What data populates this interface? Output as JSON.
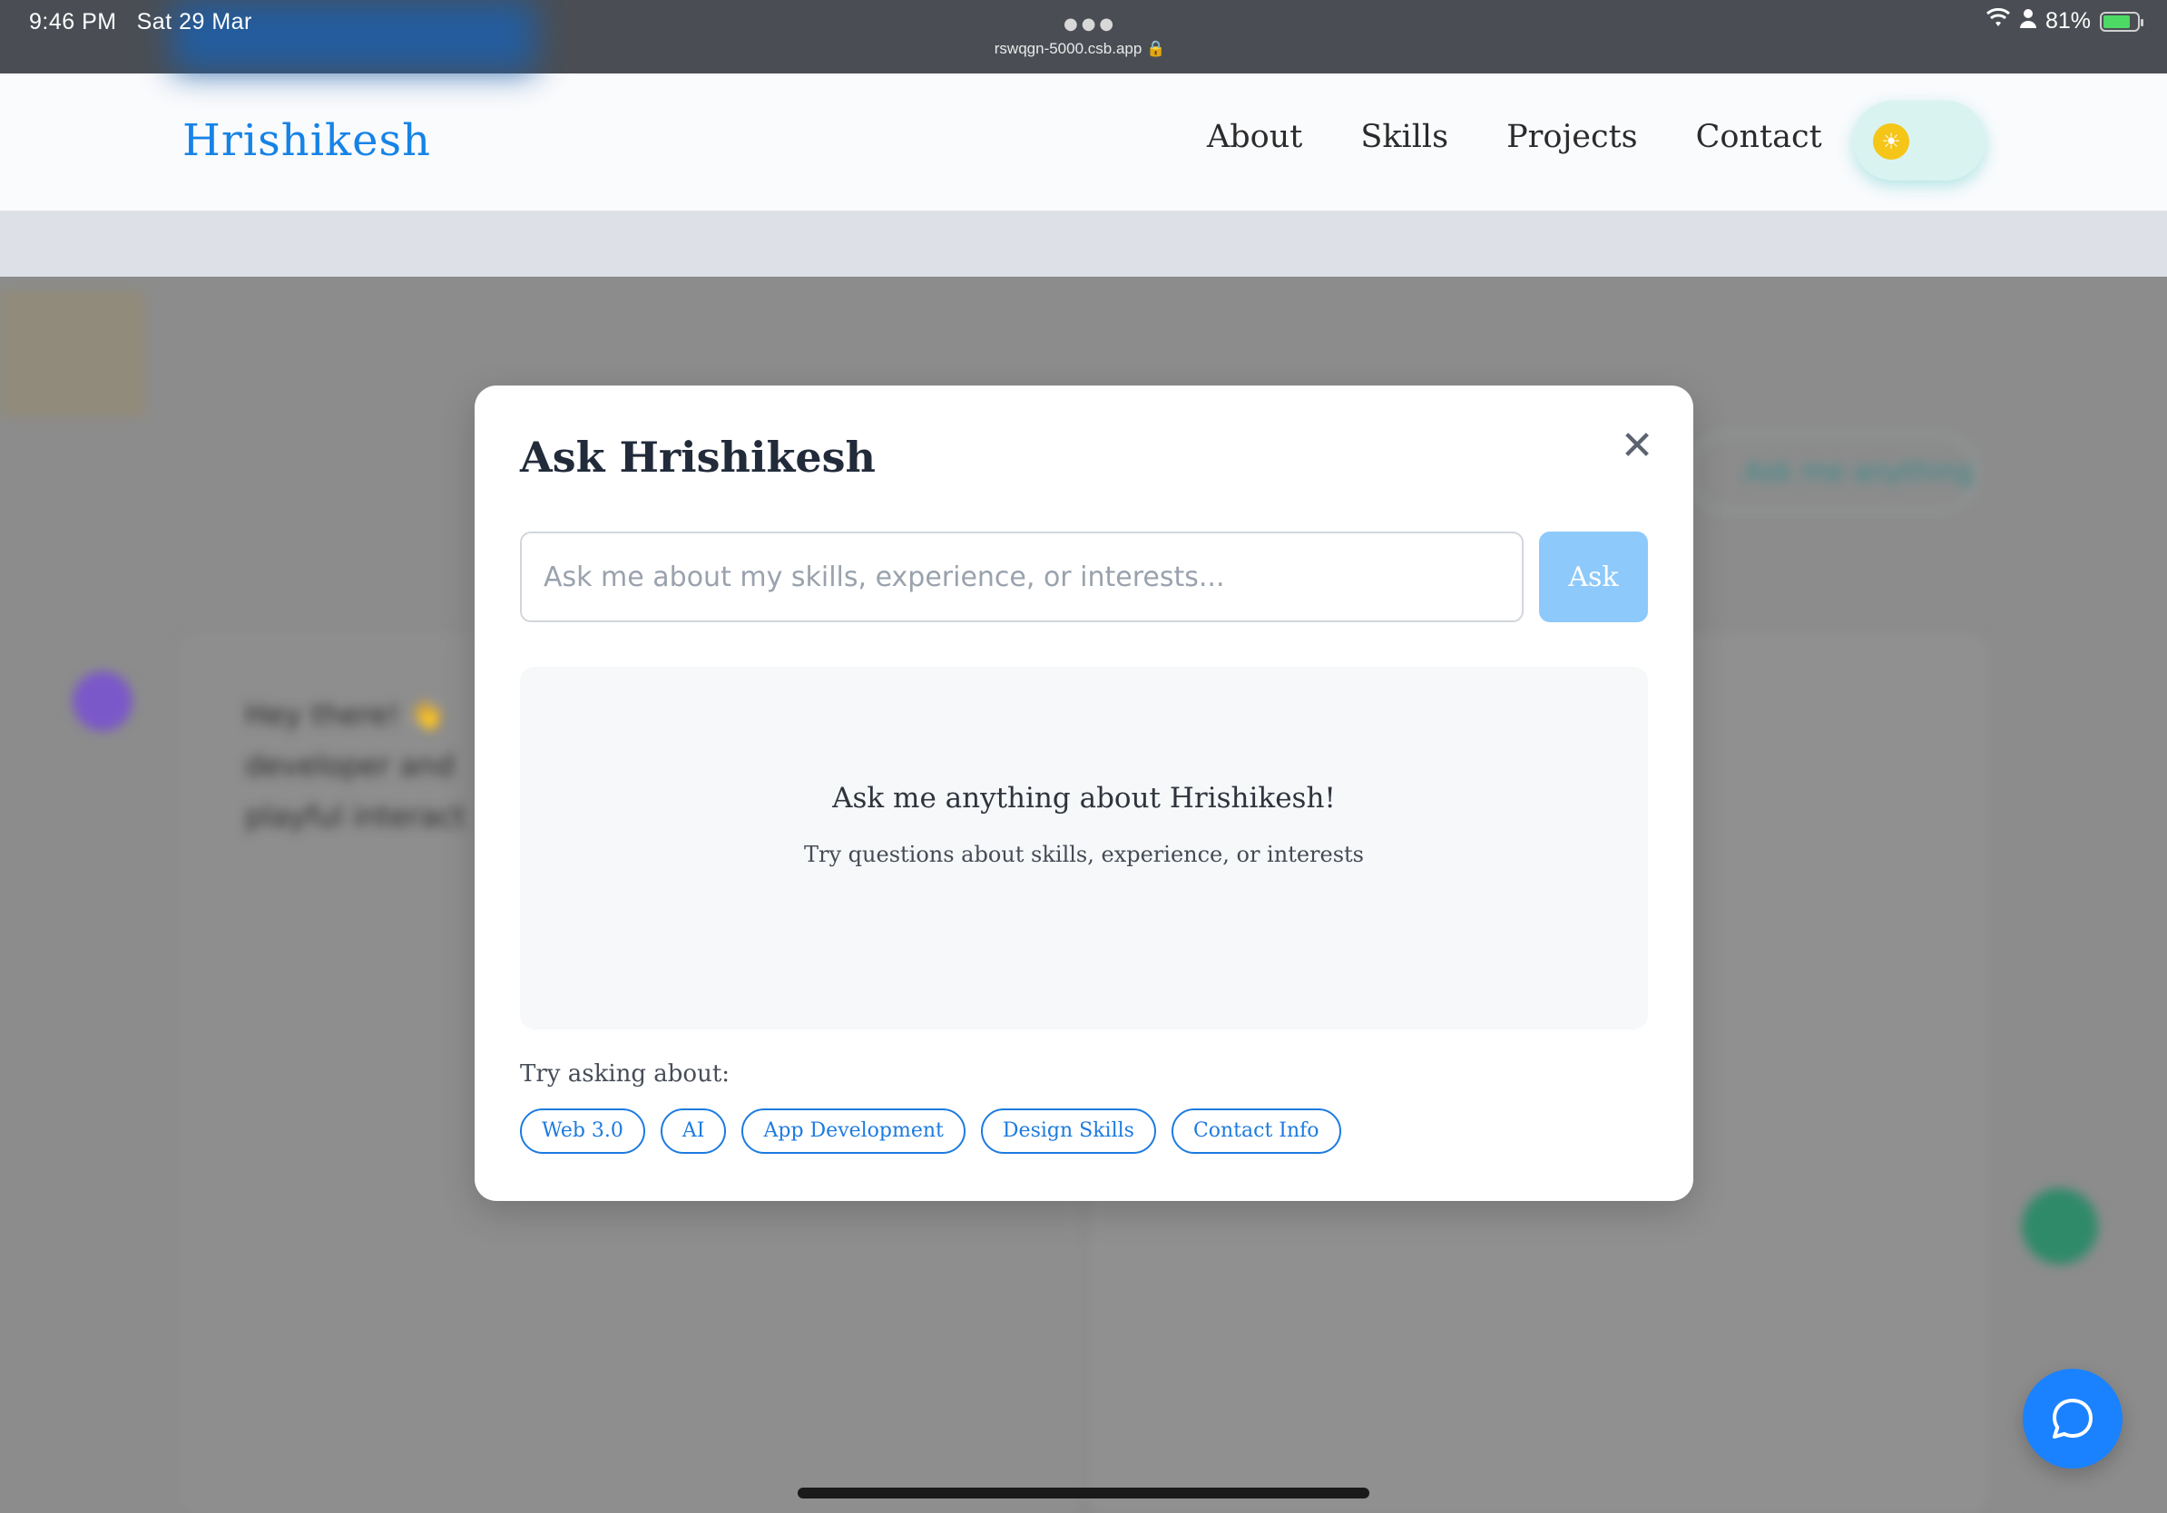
{
  "status_bar": {
    "time": "9:46 PM",
    "date": "Sat 29 Mar",
    "url": "rswqgn-5000.csb.app",
    "battery": "81%",
    "icons": [
      "dots-icon",
      "lock-icon",
      "wifi-icon",
      "person-icon",
      "battery-icon"
    ]
  },
  "header": {
    "logo": "Hrishikesh",
    "nav": [
      "About",
      "Skills",
      "Projects",
      "Contact"
    ],
    "theme_toggle_icon": "sun-icon"
  },
  "background": {
    "ask_pill": "Ask me anything",
    "intro_lines": [
      "Hey there! 👋",
      "developer and",
      "playful interact"
    ]
  },
  "modal": {
    "title": "Ask Hrishikesh",
    "close_icon": "close-icon",
    "input_placeholder": "Ask me about my skills, experience, or interests...",
    "input_value": "",
    "ask_label": "Ask",
    "empty_headline": "Ask me anything about Hrishikesh!",
    "empty_sub": "Try questions about skills, experience, or interests",
    "try_label": "Try asking about:",
    "chips": [
      "Web 3.0",
      "AI",
      "App Development",
      "Design Skills",
      "Contact Info"
    ]
  },
  "chat_fab_icon": "chat-bubble-icon",
  "colors": {
    "brand": "#1683e6",
    "ask_button": "#8ec9fb",
    "chip": "#1d7be0",
    "fab": "#1a82ff"
  }
}
